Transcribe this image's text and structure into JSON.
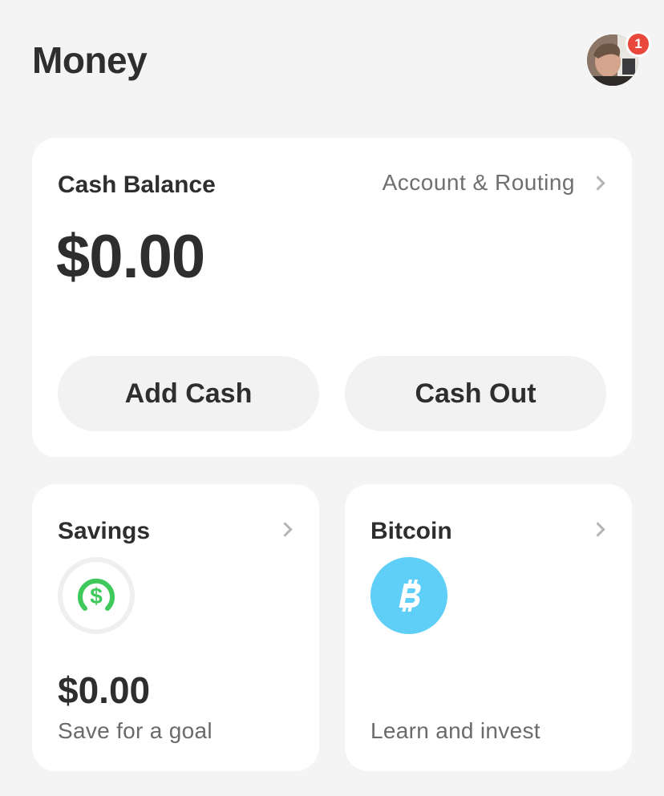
{
  "header": {
    "title": "Money",
    "notification_count": "1"
  },
  "balance_card": {
    "label": "Cash Balance",
    "account_link": "Account & Routing",
    "amount": "$0.00",
    "add_cash_label": "Add Cash",
    "cash_out_label": "Cash Out"
  },
  "savings": {
    "title": "Savings",
    "icon": "dollar-circle-icon",
    "amount": "$0.00",
    "subtitle": "Save for a goal",
    "accent_color": "#3fc95a"
  },
  "bitcoin": {
    "title": "Bitcoin",
    "icon": "bitcoin-icon",
    "subtitle": "Learn and invest",
    "accent_color": "#5fcff8"
  },
  "colors": {
    "background": "#f4f4f4",
    "card": "#ffffff",
    "badge": "#e8473c"
  }
}
